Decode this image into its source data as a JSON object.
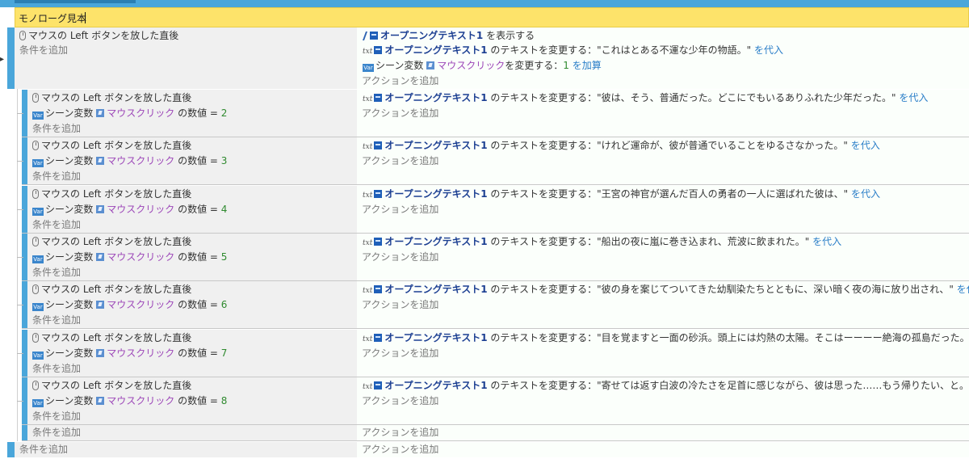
{
  "comment": {
    "text": "モノローグ見本"
  },
  "common": {
    "add_condition": "条件を追加",
    "add_action": "アクションを追加",
    "mouse_left_released_prefix": "マウスの Left ボタンを放した直後",
    "scene_var": "シーン変数",
    "var_name": "マウスクリック",
    "value_of": "の数値 =",
    "text_obj": "オープニングテキスト1",
    "change_text": "のテキストを変更する：",
    "assign": "を代入"
  },
  "main_event": {
    "action_show": {
      "obj": "オープニングテキスト1",
      "suffix": "を表示する"
    },
    "action_text": {
      "value": "\"これはとある不運な少年の物語。\""
    },
    "action_var": {
      "suffix": "を変更する：",
      "value": "1",
      "op": "を加算"
    }
  },
  "sub_events": [
    {
      "n": "2",
      "text": "\"彼は、そう、普通だった。どこにでもいるありふれた少年だった。\""
    },
    {
      "n": "3",
      "text": "\"けれど運命が、彼が普通でいることをゆるさなかった。\""
    },
    {
      "n": "4",
      "text": "\"王宮の神官が選んだ百人の勇者の一人に選ばれた彼は、\""
    },
    {
      "n": "5",
      "text": "\"船出の夜に嵐に巻き込まれ、荒波に飲まれた。\""
    },
    {
      "n": "6",
      "text": "\"彼の身を案じてついてきた幼馴染たちとともに、深い暗く夜の海に放り出され、\""
    },
    {
      "n": "7",
      "text": "\"目を覚ますと一面の砂浜。頭上には灼熱の太陽。そこはーーーー絶海の孤島だった。\""
    },
    {
      "n": "8",
      "text": "\"寄せては返す白波の冷たさを足首に感じながら、彼は思った……もう帰りたい、と。\""
    }
  ]
}
